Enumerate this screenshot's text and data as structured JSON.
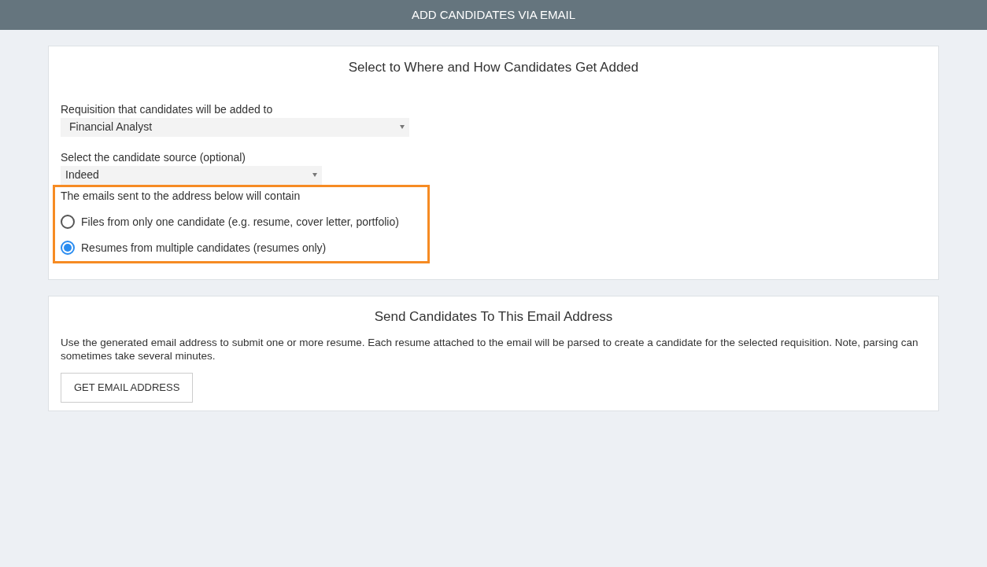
{
  "header": {
    "title": "ADD CANDIDATES VIA EMAIL"
  },
  "where_card": {
    "title": "Select to Where and How Candidates Get Added",
    "requisition": {
      "label": "Requisition that candidates will be added to",
      "value": "Financial Analyst"
    },
    "source": {
      "label": "Select the candidate source (optional)",
      "value": "Indeed"
    },
    "contents": {
      "label": "The emails sent to the address below will contain",
      "options": [
        {
          "label": "Files from only one candidate (e.g. resume, cover letter, portfolio)",
          "selected": false
        },
        {
          "label": "Resumes from multiple candidates (resumes only)",
          "selected": true
        }
      ]
    }
  },
  "email_card": {
    "title": "Send Candidates To This Email Address",
    "description": "Use the generated email address to submit one or more resume. Each resume attached to the email will be parsed to create a candidate for the selected requisition. Note, parsing can sometimes take several minutes.",
    "button": "GET EMAIL ADDRESS"
  }
}
